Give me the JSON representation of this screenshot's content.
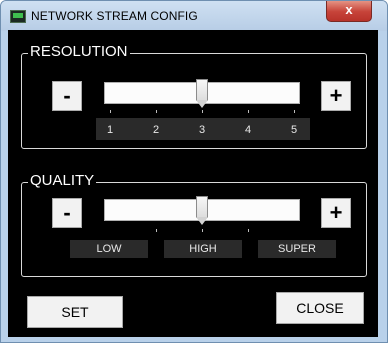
{
  "window": {
    "title": "NETWORK STREAM CONFIG",
    "close_label": "x"
  },
  "resolution": {
    "label": "RESOLUTION",
    "minus_label": "-",
    "plus_label": "+",
    "scale": [
      "1",
      "2",
      "3",
      "4",
      "5"
    ],
    "value": "3"
  },
  "quality": {
    "label": "QUALITY",
    "minus_label": "-",
    "plus_label": "+",
    "options": [
      "LOW",
      "HIGH",
      "SUPER"
    ],
    "value": "HIGH"
  },
  "buttons": {
    "set_label": "SET",
    "close_label": "CLOSE"
  }
}
